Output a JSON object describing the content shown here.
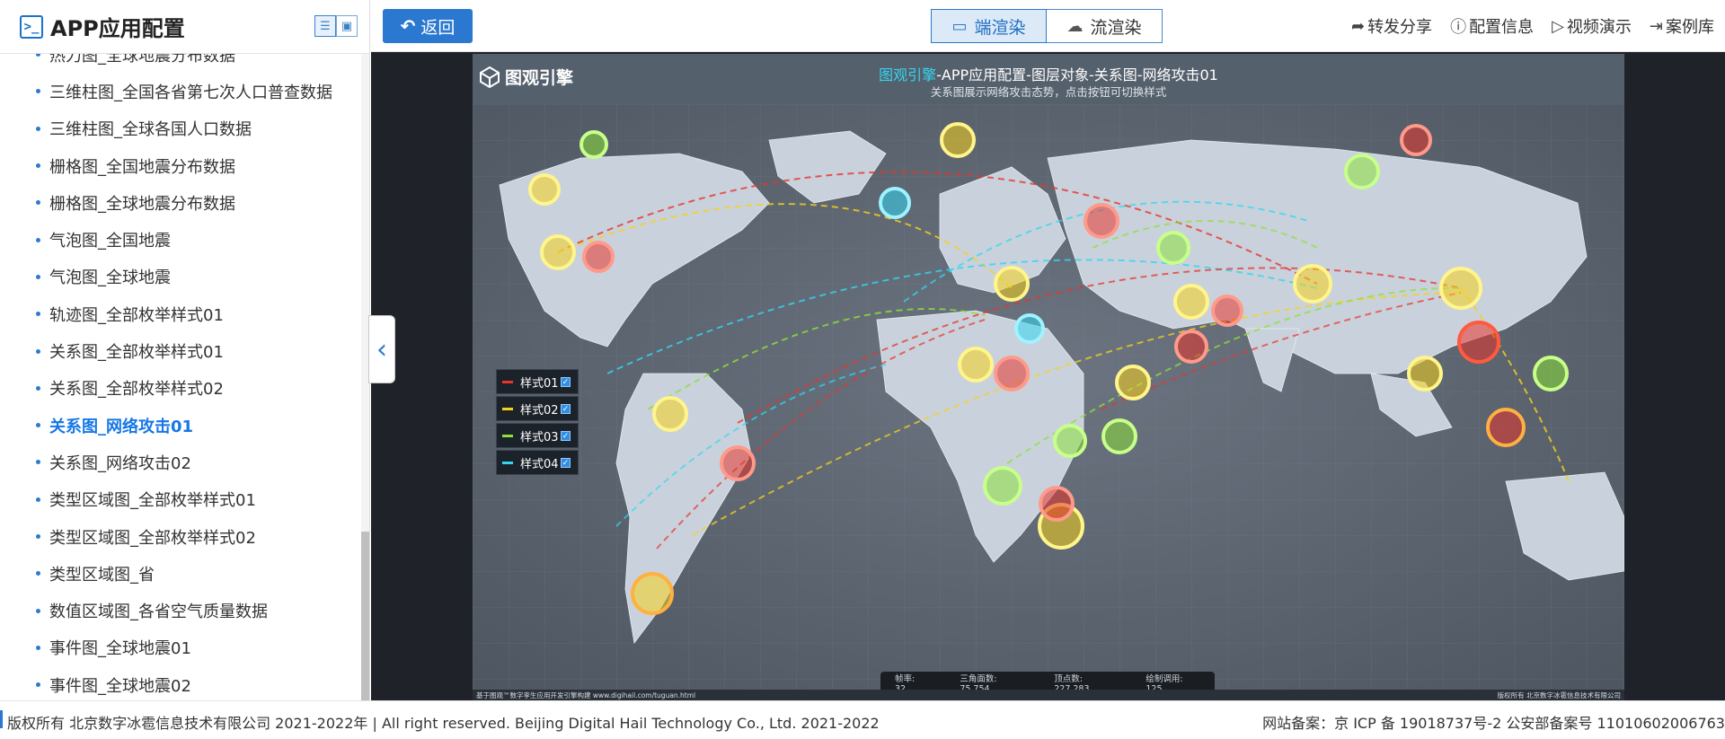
{
  "app": {
    "title": "APP应用配置"
  },
  "sidebar": {
    "items": [
      {
        "label": "热力图_全球地震分布数据"
      },
      {
        "label": "三维柱图_全国各省第七次人口普查数据"
      },
      {
        "label": "三维柱图_全球各国人口数据"
      },
      {
        "label": "栅格图_全国地震分布数据"
      },
      {
        "label": "栅格图_全球地震分布数据"
      },
      {
        "label": "气泡图_全国地震"
      },
      {
        "label": "气泡图_全球地震"
      },
      {
        "label": "轨迹图_全部枚举样式01"
      },
      {
        "label": "关系图_全部枚举样式01"
      },
      {
        "label": "关系图_全部枚举样式02"
      },
      {
        "label": "关系图_网络攻击01",
        "active": true
      },
      {
        "label": "关系图_网络攻击02"
      },
      {
        "label": "类型区域图_全部枚举样式01"
      },
      {
        "label": "类型区域图_全部枚举样式02"
      },
      {
        "label": "类型区域图_省"
      },
      {
        "label": "数值区域图_各省空气质量数据"
      },
      {
        "label": "事件图_全球地震01"
      },
      {
        "label": "事件图_全球地震02"
      }
    ]
  },
  "toolbar": {
    "back_label": "返回",
    "render_client": "端渲染",
    "render_stream": "流渲染",
    "share": "转发分享",
    "config_info": "配置信息",
    "video_demo": "视频演示",
    "case_library": "案例库"
  },
  "map": {
    "brand": "图观引擎",
    "title_highlight": "图观引擎",
    "title_rest": "-APP应用配置-图层对象-关系图-网络攻击01",
    "subtitle": "关系图展示网络攻击态势，点击按钮可切换样式",
    "legend": [
      {
        "label": "样式01",
        "color": "#e8342c",
        "checked": true
      },
      {
        "label": "样式02",
        "color": "#f5d21c",
        "checked": true
      },
      {
        "label": "样式03",
        "color": "#8de03a",
        "checked": true
      },
      {
        "label": "样式04",
        "color": "#34d6f0",
        "checked": true
      }
    ],
    "stats": {
      "fps_label": "帧率:",
      "fps": "32",
      "tri_label": "三角面数:",
      "tri": "75,754",
      "vert_label": "顶点数:",
      "vert": "227,283",
      "draw_label": "绘制调用:",
      "draw": "125"
    },
    "foot_left": "基于图观™数字孪生应用开发引擎构建 www.digihail.com/tuguan.html",
    "foot_right": "版权所有 北京数字冰雹信息技术有限公司"
  },
  "footer": {
    "copyright": "版权所有 北京数字冰雹信息技术有限公司 2021-2022年 | All right reserved. Beijing Digital Hail Technology Co., Ltd. 2021-2022",
    "icp": "网站备案：京 ICP 备 19018737号-2 公安部备案号 11010602006763"
  }
}
